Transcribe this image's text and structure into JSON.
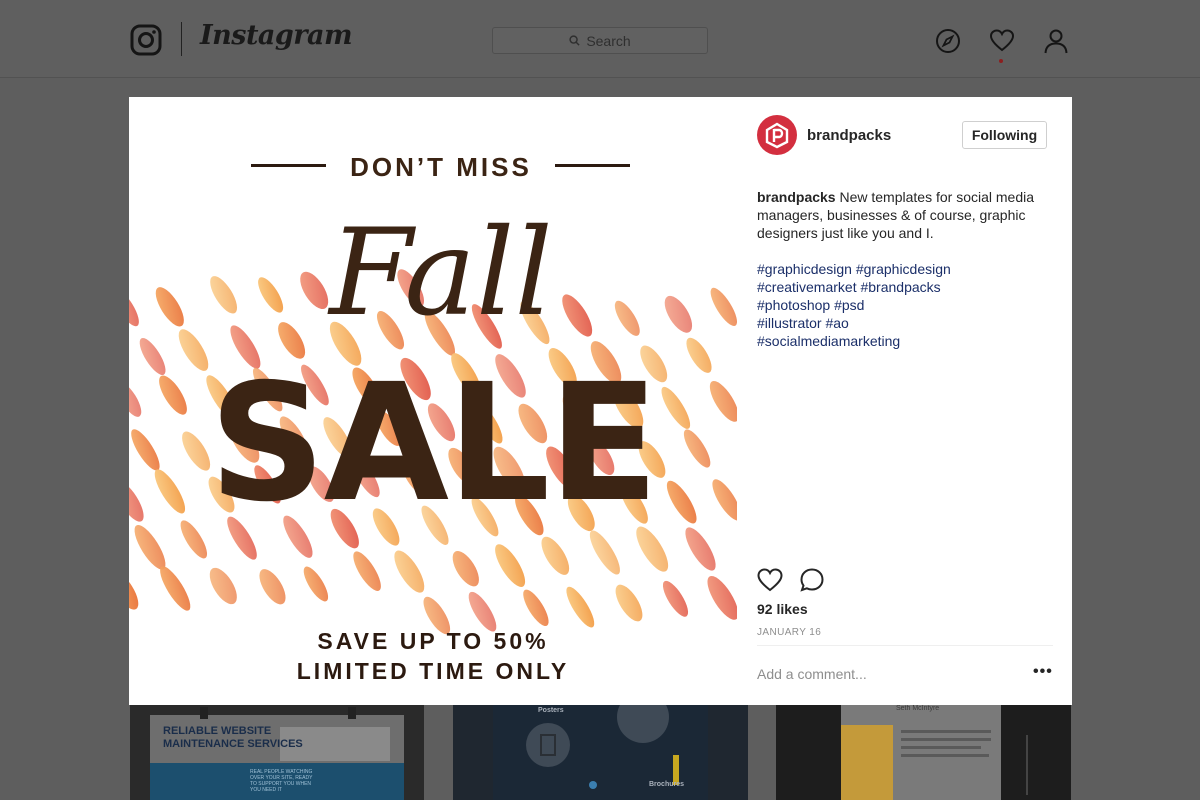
{
  "topbar": {
    "app_name": "Instagram",
    "search_placeholder": "Search"
  },
  "post": {
    "image": {
      "kicker": "DON’T MISS",
      "script_word": "Fall",
      "headline": "SALE",
      "line1": "SAVE UP TO 50%",
      "line2": "LIMITED TIME ONLY",
      "colors": {
        "text": "#3b2414",
        "accent_warm": "#f08a3c",
        "accent_red": "#e55a4a"
      }
    },
    "author": "brandpacks",
    "follow_label": "Following",
    "caption_user": "brandpacks",
    "caption_text": " New templates for social media managers, businesses & of course, graphic designers just like you and I.",
    "hashtags": [
      "#graphicdesign #graphicdesign",
      "#creativemarket #brandpacks",
      "#photoshop #psd",
      "#illustrator #ao",
      "#socialmediamarketing"
    ],
    "likes": "92 likes",
    "date": "JANUARY 16",
    "comment_placeholder": "Add a comment...",
    "more_label": "•••"
  },
  "background_tiles": {
    "tile1_line1": "RELIABLE WEBSITE",
    "tile1_line2": "MAINTENANCE SERVICES",
    "tile1_small": "REAL PEOPLE WATCHING OVER YOUR SITE, READY TO SUPPORT YOU WHEN YOU NEED IT",
    "tile2_label1": "Posters",
    "tile2_label2": "Brochures",
    "tile3_label": "Seth McIntyre"
  },
  "colors": {
    "brand_red": "#d32f3f",
    "hashtag": "#1b2f69",
    "overlay": "#5e5e5e"
  }
}
